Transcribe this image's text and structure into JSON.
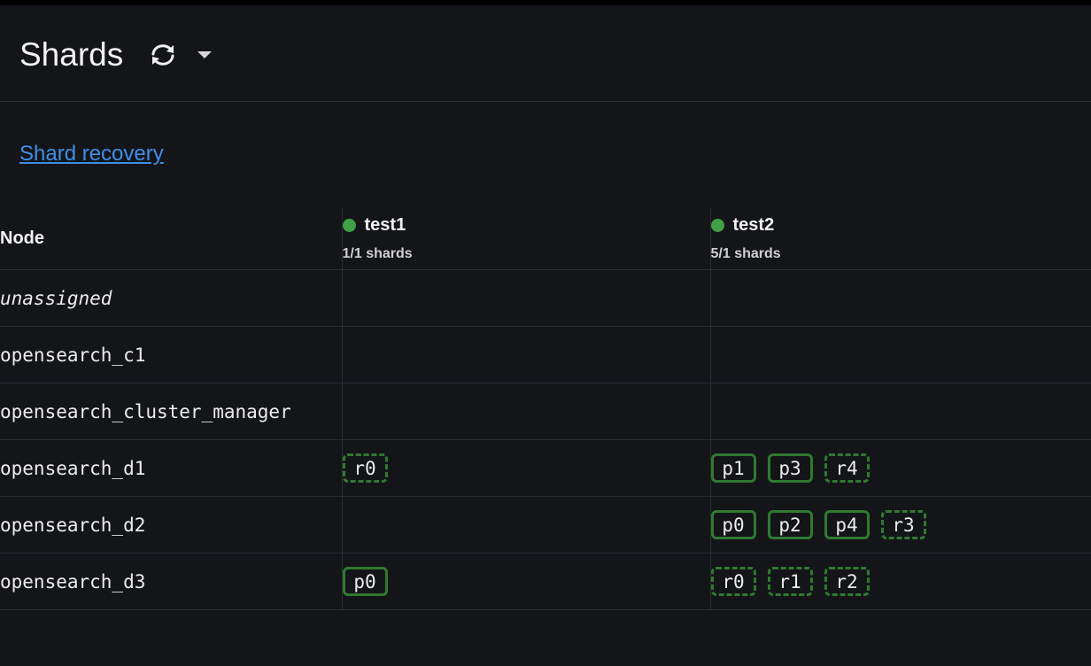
{
  "header": {
    "title": "Shards"
  },
  "links": {
    "shard_recovery": "Shard recovery"
  },
  "table": {
    "node_header": "Node",
    "indices": [
      {
        "name": "test1",
        "shards": "1/1 shards",
        "health_color": "#3fa045"
      },
      {
        "name": "test2",
        "shards": "5/1 shards",
        "health_color": "#3fa045"
      }
    ],
    "rows": [
      {
        "node": "unassigned",
        "test1": [],
        "test2": []
      },
      {
        "node": "opensearch_c1",
        "test1": [],
        "test2": []
      },
      {
        "node": "opensearch_cluster_manager",
        "test1": [],
        "test2": []
      },
      {
        "node": "opensearch_d1",
        "test1": [
          {
            "label": "r0",
            "type": "replica"
          }
        ],
        "test2": [
          {
            "label": "p1",
            "type": "primary"
          },
          {
            "label": "p3",
            "type": "primary"
          },
          {
            "label": "r4",
            "type": "replica"
          }
        ]
      },
      {
        "node": "opensearch_d2",
        "test1": [],
        "test2": [
          {
            "label": "p0",
            "type": "primary"
          },
          {
            "label": "p2",
            "type": "primary"
          },
          {
            "label": "p4",
            "type": "primary"
          },
          {
            "label": "r3",
            "type": "replica"
          }
        ]
      },
      {
        "node": "opensearch_d3",
        "test1": [
          {
            "label": "p0",
            "type": "primary"
          }
        ],
        "test2": [
          {
            "label": "r0",
            "type": "replica"
          },
          {
            "label": "r1",
            "type": "replica"
          },
          {
            "label": "r2",
            "type": "replica"
          }
        ]
      }
    ]
  },
  "icons": {
    "refresh": "refresh-icon",
    "caret": "caret-down-icon"
  },
  "colors": {
    "background": "#141519",
    "link": "#3f8ee8",
    "shard_border": "#2f7a30",
    "health_green": "#3fa045"
  }
}
